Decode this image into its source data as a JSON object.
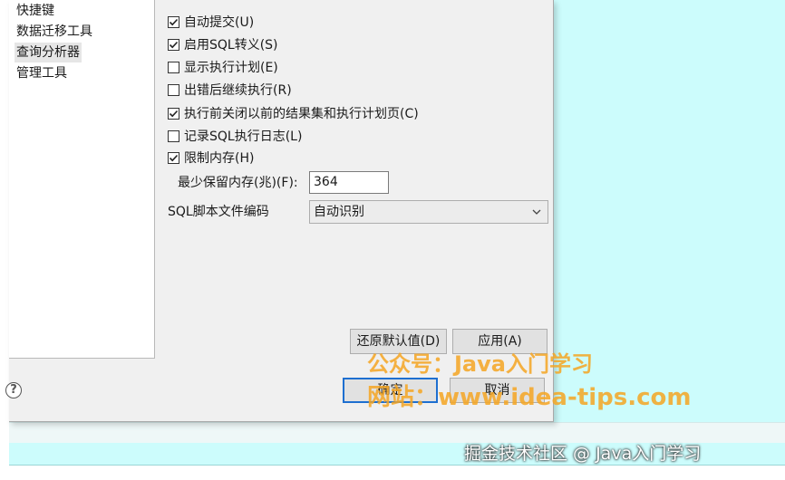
{
  "tree": {
    "items": [
      "快捷键",
      "数据迁移工具",
      "查询分析器",
      "管理工具"
    ],
    "selected": "查询分析器"
  },
  "options": [
    {
      "label": "自动提交(U)",
      "checked": true
    },
    {
      "label": "启用SQL转义(S)",
      "checked": true
    },
    {
      "label": "显示执行计划(E)",
      "checked": false
    },
    {
      "label": "出错后继续执行(R)",
      "checked": false
    },
    {
      "label": "执行前关闭以前的结果集和执行计划页(C)",
      "checked": true
    },
    {
      "label": "记录SQL执行日志(L)",
      "checked": false
    },
    {
      "label": "限制内存(H)",
      "checked": true
    }
  ],
  "min_memory": {
    "label": "最少保留内存(兆)(F):",
    "value": "364"
  },
  "encoding": {
    "label": "SQL脚本文件编码",
    "value": "自动识别",
    "icon": "chevron-down-icon"
  },
  "buttons": {
    "restore_defaults": "还原默认值(D)",
    "apply": "应用(A)",
    "ok": "确定",
    "cancel": "取消",
    "help": "?"
  },
  "watermark": {
    "line1": "公众号：Java入门学习",
    "line2": "网站：www.idea-tips.com",
    "credit": "掘金技术社区 @ Java入门学习"
  },
  "colors": {
    "accent": "#1e6fd0",
    "background": "#ccfcfc",
    "watermark": "#f5a623"
  }
}
